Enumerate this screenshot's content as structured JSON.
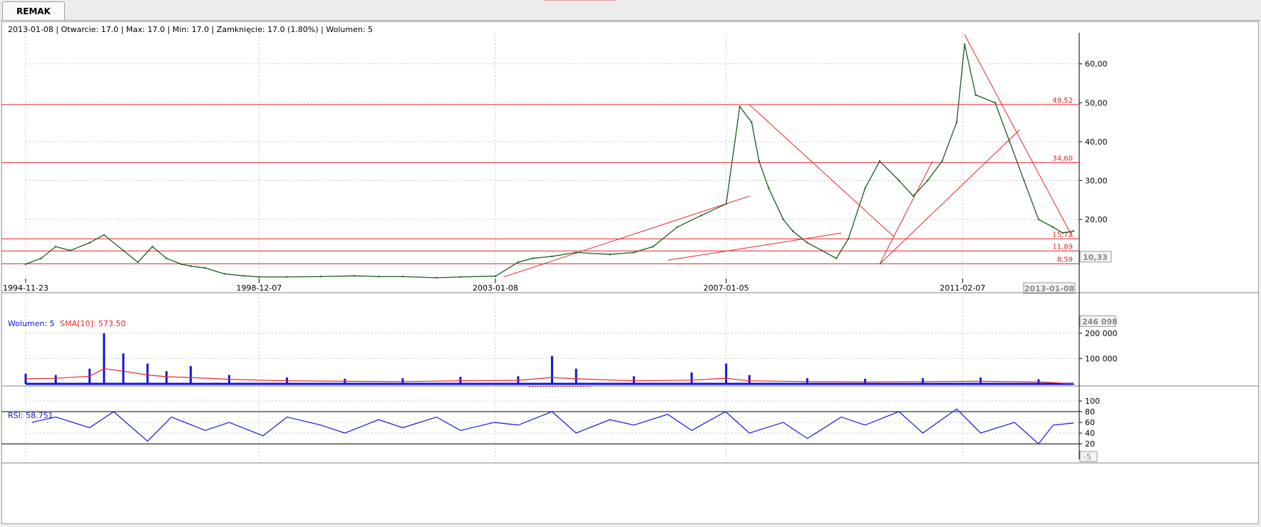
{
  "tab": {
    "label": "REMAK"
  },
  "price_info": "2013-01-08 | Otwarcie: 17.0 | Max: 17.0 | Min: 17.0 | Zamknięcie: 17.0 (1.80%)  | Wolumen: 5",
  "volume_info": {
    "label": "Wolumen: 5",
    "sma_label": "SMA[10]: 573.50"
  },
  "rsi_info": "RSI: 58.751",
  "colors": {
    "price": "#1a5c1a",
    "lines": "#e8262b",
    "volume": "#1515d8",
    "sma": "#e8262b",
    "rsi": "#1515d8",
    "grid": "#c8c8c8"
  },
  "chart_data": [
    {
      "type": "line",
      "name": "price",
      "x_ticks": [
        "1994-11-23",
        "1998-12-07",
        "2003-01-08",
        "2007-01-05",
        "2011-02-07"
      ],
      "x_current": "2013-01-08",
      "y_ticks": [
        "60,00",
        "50,00",
        "40,00",
        "30,00",
        "20,00"
      ],
      "y_current": "10,33",
      "ylim": [
        5,
        68
      ],
      "grid": true,
      "x": [
        "1994-11-23",
        "1995-03-01",
        "1995-06-01",
        "1995-09-01",
        "1996-01-01",
        "1996-04-01",
        "1996-08-01",
        "1996-11-01",
        "1997-02-01",
        "1997-05-01",
        "1997-08-01",
        "1997-10-01",
        "1998-01-01",
        "1998-05-01",
        "1998-09-01",
        "1998-12-07",
        "1999-06-01",
        "2000-01-01",
        "2000-08-01",
        "2001-01-01",
        "2001-06-01",
        "2002-01-01",
        "2002-06-01",
        "2003-01-08",
        "2003-06-01",
        "2003-09-01",
        "2004-01-01",
        "2004-06-01",
        "2005-01-01",
        "2005-06-01",
        "2005-10-01",
        "2006-03-01",
        "2006-08-01",
        "2007-01-05",
        "2007-04-01",
        "2007-06-15",
        "2007-08-01",
        "2007-10-01",
        "2008-01-01",
        "2008-03-01",
        "2008-06-01",
        "2008-09-01",
        "2008-12-01",
        "2009-02-15",
        "2009-06-01",
        "2009-09-01",
        "2010-01-01",
        "2010-04-01",
        "2010-07-01",
        "2010-10-01",
        "2011-01-01",
        "2011-02-20",
        "2011-05-01",
        "2011-09-01",
        "2011-12-01",
        "2012-03-01",
        "2012-06-01",
        "2012-09-01",
        "2012-11-01",
        "2013-01-08"
      ],
      "y": [
        8.5,
        10,
        13,
        12,
        14,
        16,
        12,
        9,
        13,
        10,
        8.5,
        8,
        7.5,
        6,
        5.5,
        5.2,
        5.2,
        5.3,
        5.5,
        5.3,
        5.3,
        5.0,
        5.2,
        5.4,
        9,
        10,
        10.5,
        11.5,
        11,
        11.5,
        13,
        18,
        21,
        24,
        49,
        45,
        35,
        28,
        20,
        17,
        14,
        12,
        10,
        15,
        28,
        35,
        30,
        26,
        30,
        35,
        45,
        65,
        52,
        50,
        40,
        30,
        20,
        18,
        16.5,
        17
      ],
      "levels": [
        49.52,
        34.6,
        15.0,
        11.89,
        8.59
      ],
      "level_labels": [
        "49,52",
        "34,60",
        "15,72",
        "11,89",
        "8,59"
      ],
      "trendlines": [
        [
          [
            "2003-03-01",
            5.2
          ],
          [
            "2007-06-01",
            26
          ]
        ],
        [
          [
            "2006-01-01",
            9.5
          ],
          [
            "2009-01-01",
            16.5
          ]
        ],
        [
          [
            "2007-06-01",
            49.5
          ],
          [
            "2009-12-01",
            15.5
          ]
        ],
        [
          [
            "2009-09-01",
            8.5
          ],
          [
            "2012-02-01",
            43
          ]
        ],
        [
          [
            "2009-09-01",
            8.5
          ],
          [
            "2010-08-01",
            35
          ]
        ],
        [
          [
            "2011-02-20",
            67.5
          ],
          [
            "2013-01-01",
            15.5
          ]
        ]
      ]
    },
    {
      "type": "bar",
      "name": "volume",
      "y_ticks": [
        "200 000",
        "100 000"
      ],
      "y_current": "246 098",
      "ylim": [
        0,
        250000
      ],
      "x": [
        "1994-11-23",
        "1995-06-01",
        "1996-01-01",
        "1996-04-01",
        "1996-08-01",
        "1997-01-01",
        "1997-05-01",
        "1997-10-01",
        "1998-06-01",
        "1999-06-01",
        "2000-06-01",
        "2001-06-01",
        "2002-06-01",
        "2003-06-01",
        "2004-01-01",
        "2004-06-01",
        "2005-06-01",
        "2006-06-01",
        "2007-01-05",
        "2007-06-01",
        "2008-06-01",
        "2009-06-01",
        "2010-06-01",
        "2011-06-01",
        "2012-06-01",
        "2013-01-08"
      ],
      "values": [
        40000,
        35000,
        60000,
        200000,
        120000,
        80000,
        50000,
        70000,
        35000,
        25000,
        20000,
        22000,
        28000,
        30000,
        110000,
        60000,
        30000,
        45000,
        80000,
        35000,
        22000,
        20000,
        22000,
        25000,
        18000,
        5
      ],
      "sma_values": [
        20000,
        22000,
        30000,
        60000,
        50000,
        35000,
        28000,
        25000,
        18000,
        12000,
        10000,
        9000,
        12000,
        14000,
        25000,
        20000,
        12000,
        15000,
        22000,
        12000,
        9000,
        8000,
        9000,
        10000,
        8000,
        573.5
      ]
    },
    {
      "type": "line",
      "name": "rsi",
      "y_ticks": [
        "100",
        "80",
        "60",
        "40",
        "20"
      ],
      "y_current": "-5",
      "ylim": [
        -5,
        100
      ],
      "levels": [
        80,
        20
      ],
      "x": [
        "1995-01-01",
        "1995-06-01",
        "1996-01-01",
        "1996-06-01",
        "1997-01-01",
        "1997-06-01",
        "1998-01-01",
        "1998-06-01",
        "1999-01-01",
        "1999-06-01",
        "2000-01-01",
        "2000-06-01",
        "2001-01-01",
        "2001-06-01",
        "2002-01-01",
        "2002-06-01",
        "2003-01-01",
        "2003-06-01",
        "2004-01-01",
        "2004-06-01",
        "2005-01-01",
        "2005-06-01",
        "2006-01-01",
        "2006-06-01",
        "2007-01-01",
        "2007-06-01",
        "2008-01-01",
        "2008-06-01",
        "2009-01-01",
        "2009-06-01",
        "2010-01-01",
        "2010-06-01",
        "2011-01-01",
        "2011-06-01",
        "2012-01-01",
        "2012-06-01",
        "2012-09-01",
        "2013-01-08"
      ],
      "y": [
        60,
        70,
        50,
        80,
        25,
        70,
        45,
        60,
        35,
        70,
        55,
        40,
        65,
        50,
        70,
        45,
        60,
        55,
        80,
        40,
        65,
        55,
        75,
        45,
        80,
        40,
        60,
        30,
        70,
        55,
        80,
        40,
        85,
        40,
        60,
        20,
        55,
        58.751
      ]
    }
  ]
}
